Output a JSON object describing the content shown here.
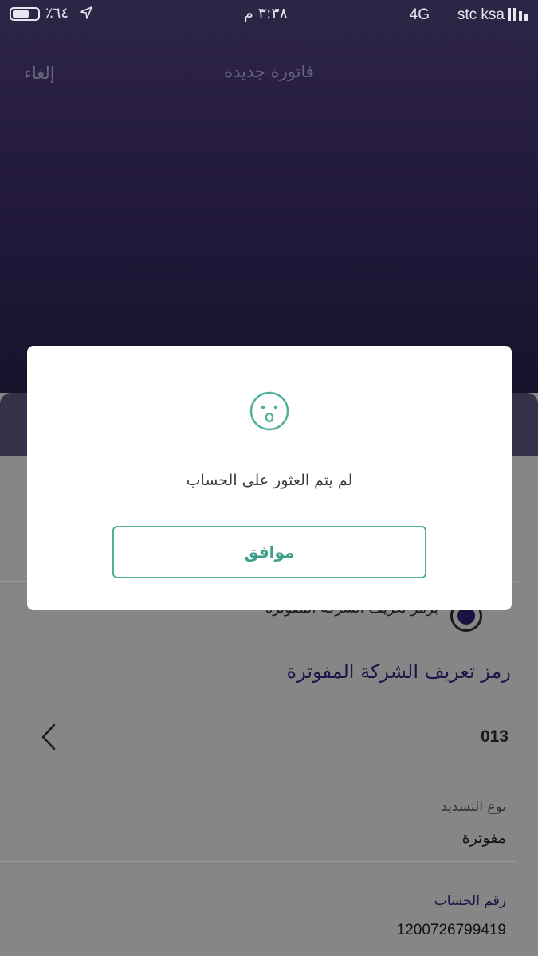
{
  "status_bar": {
    "carrier": "stc ksa",
    "network": "4G",
    "time": "٣:٣٨ م",
    "battery_percent": "٪٦٤",
    "battery_level": 0.64,
    "location_icon": "location-arrow-icon",
    "signal_icon": "signal-bars-icon"
  },
  "nav": {
    "title": "فاتورة جديدة",
    "cancel": "إلغاء"
  },
  "form": {
    "radio_option": "برمز تعريف الشركة المفوترة",
    "section_title": "رمز تعريف الشركة المفوترة",
    "biller_code": "013",
    "payment_type_label": "نوع التسديد",
    "payment_type_value": "مفوترة",
    "account_number_label": "رقم الحساب",
    "account_number_value": "1200726799419"
  },
  "modal": {
    "icon": "surprised-face-icon",
    "message": "لم يتم العثور على الحساب",
    "ok_button": "موافق"
  },
  "colors": {
    "header_bg": "#231a3f",
    "accent": "#4fb09b",
    "text_dark_purple": "#1d1447"
  }
}
